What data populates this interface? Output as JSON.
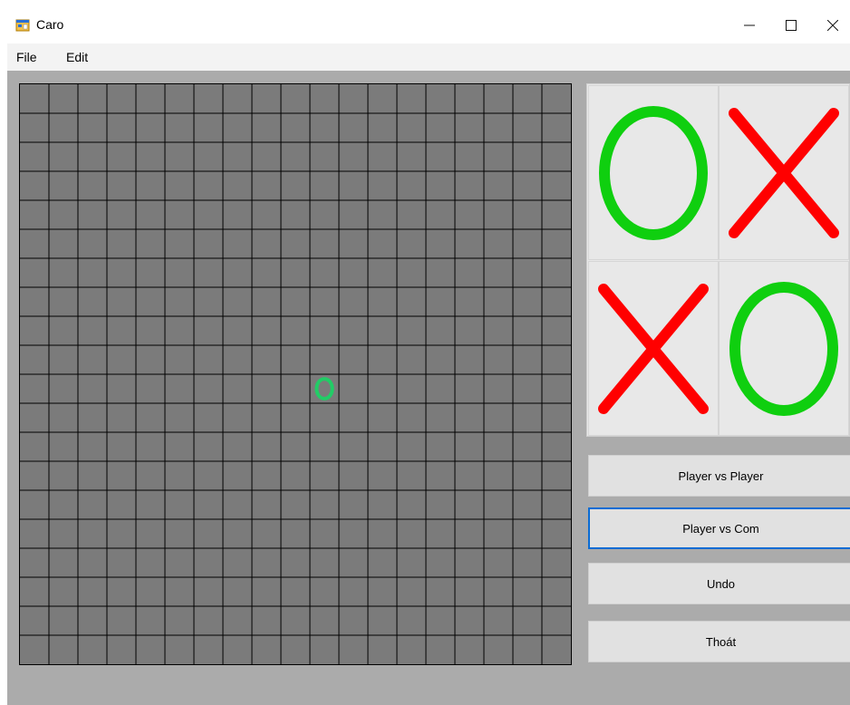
{
  "window": {
    "title": "Caro",
    "icons": {
      "app": "app-form-icon",
      "minimize": "minimize-icon",
      "maximize": "maximize-icon",
      "close": "close-icon"
    }
  },
  "menu": {
    "items": [
      "File",
      "Edit"
    ]
  },
  "board": {
    "rows": 20,
    "columns": 19,
    "background": "#7b7b7b",
    "pieces": [
      {
        "mark": "O",
        "row": 10,
        "col": 10,
        "color": "#22cc66"
      }
    ]
  },
  "preview_panel": {
    "cells": [
      {
        "mark": "O",
        "color": "#0fcf0f"
      },
      {
        "mark": "X",
        "color": "#ff0000"
      },
      {
        "mark": "X",
        "color": "#ff0000"
      },
      {
        "mark": "O",
        "color": "#0fcf0f"
      }
    ]
  },
  "buttons": {
    "player_vs_player": "Player vs Player",
    "player_vs_com": "Player vs Com",
    "undo": "Undo",
    "exit": "Thoát"
  },
  "colors": {
    "focus_border": "#0a6cd4",
    "client_background": "#ababab"
  }
}
